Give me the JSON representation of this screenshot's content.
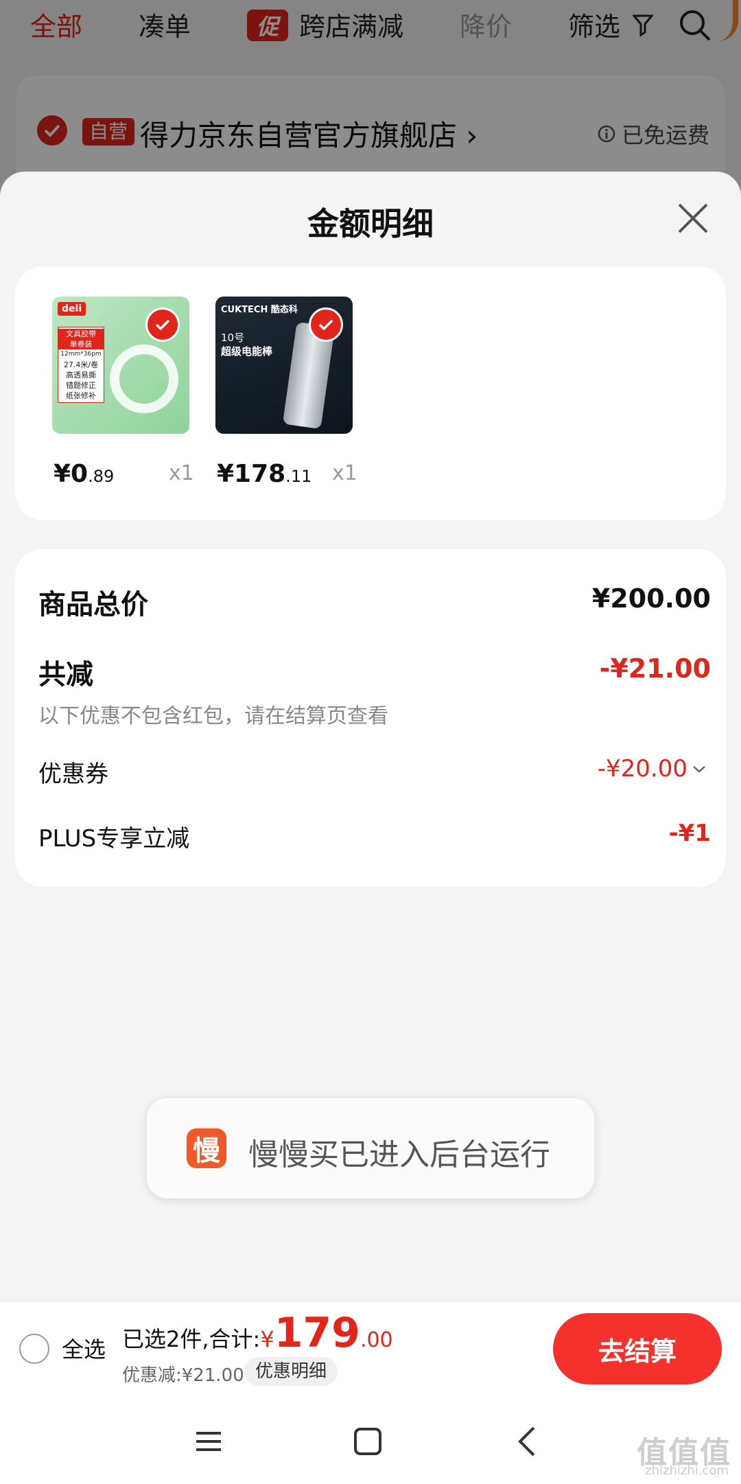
{
  "filter_bar": {
    "tabs": [
      {
        "label": "全部",
        "state": "active"
      },
      {
        "label": "凑单",
        "state": "normal"
      },
      {
        "label": "跨店满减",
        "state": "normal",
        "badge": "促"
      },
      {
        "label": "降价",
        "state": "muted"
      },
      {
        "label": "筛选",
        "state": "normal"
      }
    ],
    "filter_icon": "funnel-icon",
    "search_icon": "search-icon"
  },
  "store": {
    "badge": "自营",
    "name": "得力京东自营官方旗舰店",
    "arrow": "›",
    "shipping": "已免运费",
    "info_icon": "info-icon"
  },
  "sheet": {
    "title": "金额明细",
    "close_icon": "close-icon"
  },
  "products": [
    {
      "name": "deli tape",
      "price_int": "¥0",
      "price_dec": ".89",
      "qty": "x1",
      "selected": true,
      "thumb_brand": "deli",
      "thumb_lines": [
        "文具胶带",
        "单卷装",
        "12mm*36pm",
        "27.4米/卷",
        "高透易撕",
        "错题修正",
        "纸张修补"
      ]
    },
    {
      "name": "CUKTECH power bank",
      "price_int": "¥178",
      "price_dec": ".11",
      "qty": "x1",
      "selected": true,
      "thumb_brand": "CUKTECH 酷态科",
      "thumb_lines": [
        "10号",
        "超级电能棒"
      ]
    }
  ],
  "summary": {
    "total_label": "商品总价",
    "total_value": "¥200.00",
    "reduce_label": "共减",
    "reduce_value": "-¥21.00",
    "reduce_note": "以下优惠不包含红包，请在结算页查看",
    "coupon_label": "优惠券",
    "coupon_value": "-¥20.00",
    "plus_label": "PLUS专享立减",
    "plus_value": "-¥1"
  },
  "toast": {
    "icon_char": "慢",
    "text": "慢慢买已进入后台运行"
  },
  "checkout": {
    "select_all": "全选",
    "selected_text": "已选2件,合计:",
    "currency": "¥",
    "total_int": "179",
    "total_dec": ".00",
    "discount_text": "优惠减:¥21.00",
    "discount_button": "优惠明细",
    "checkout_button": "去结算"
  },
  "nav": {
    "menu_icon": "menu-icon",
    "home_icon": "home-icon",
    "back_icon": "back-icon"
  },
  "watermark": {
    "text": "值值值",
    "sub": "zhizhizhi.com"
  },
  "colors": {
    "accent": "#e1251b",
    "checkout": "#f5312e"
  }
}
